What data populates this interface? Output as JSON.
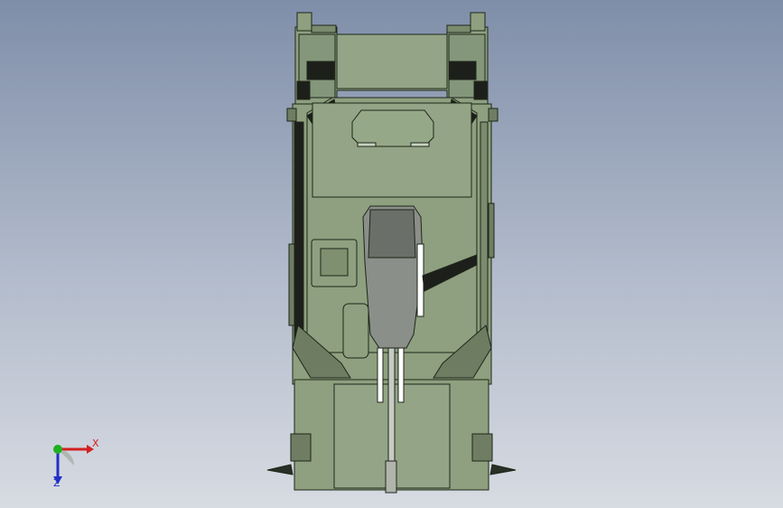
{
  "view": {
    "background_top": "#7f8ea9",
    "background_bottom": "#d7dbe2",
    "model_color": "#8ea07f"
  },
  "triad": {
    "x_label": "X",
    "z_label": "Z",
    "x_color": "#d22020",
    "y_color": "#20b020",
    "z_color": "#2030c8"
  }
}
